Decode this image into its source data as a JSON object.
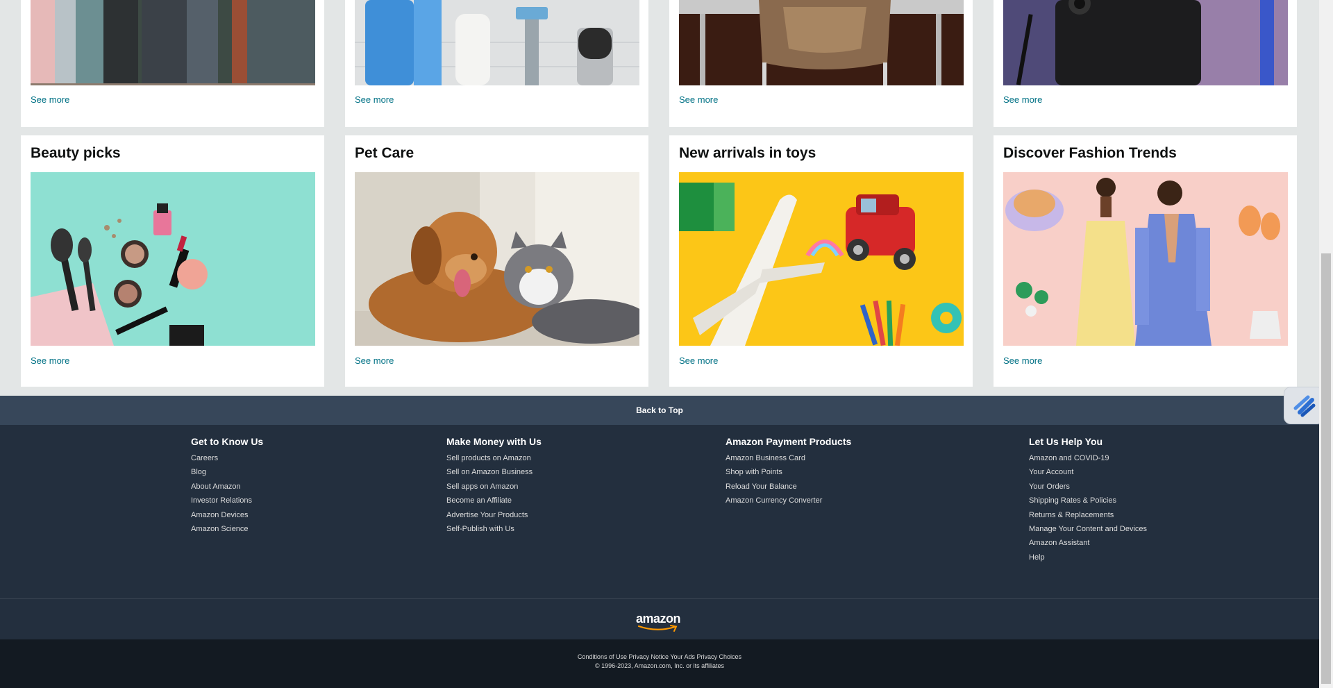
{
  "top_row": {
    "see_more": [
      "See more",
      "See more",
      "See more",
      "See more"
    ]
  },
  "cards": [
    {
      "title": "Beauty picks",
      "see_more": "See more"
    },
    {
      "title": "Pet Care",
      "see_more": "See more"
    },
    {
      "title": "New arrivals in toys",
      "see_more": "See more"
    },
    {
      "title": "Discover Fashion Trends",
      "see_more": "See more"
    }
  ],
  "footer": {
    "back_to_top": "Back to Top",
    "columns": [
      {
        "heading": "Get to Know Us",
        "links": [
          "Careers",
          "Blog",
          "About Amazon",
          "Investor Relations",
          "Amazon Devices",
          "Amazon Science"
        ]
      },
      {
        "heading": "Make Money with Us",
        "links": [
          "Sell products on Amazon",
          "Sell on Amazon Business",
          "Sell apps on Amazon",
          "Become an Affiliate",
          "Advertise Your Products",
          "Self-Publish with Us"
        ]
      },
      {
        "heading": "Amazon Payment Products",
        "links": [
          "Amazon Business Card",
          "Shop with Points",
          "Reload Your Balance",
          "Amazon Currency Converter"
        ]
      },
      {
        "heading": "Let Us Help You",
        "links": [
          "Amazon and COVID-19",
          "Your Account",
          "Your Orders",
          "Shipping Rates & Policies",
          "Returns & Replacements",
          "Manage Your Content and Devices",
          "Amazon Assistant",
          "Help"
        ]
      }
    ],
    "logo_text": "amazon",
    "legal_links": [
      "Conditions of Use",
      "Privacy Notice",
      "Your Ads Privacy Choices"
    ],
    "copyright": "© 1996-2023, Amazon.com, Inc. or its affiliates"
  },
  "icons": {
    "floating_widget": "lightning-bolt-icon",
    "logo_smile": "amazon-smile-arrow-icon"
  },
  "colors": {
    "link": "#007185",
    "back_to_top": "#37475a",
    "footer": "#232f3e",
    "footer_bottom": "#131a22",
    "page_bg": "#e3e6e6"
  }
}
